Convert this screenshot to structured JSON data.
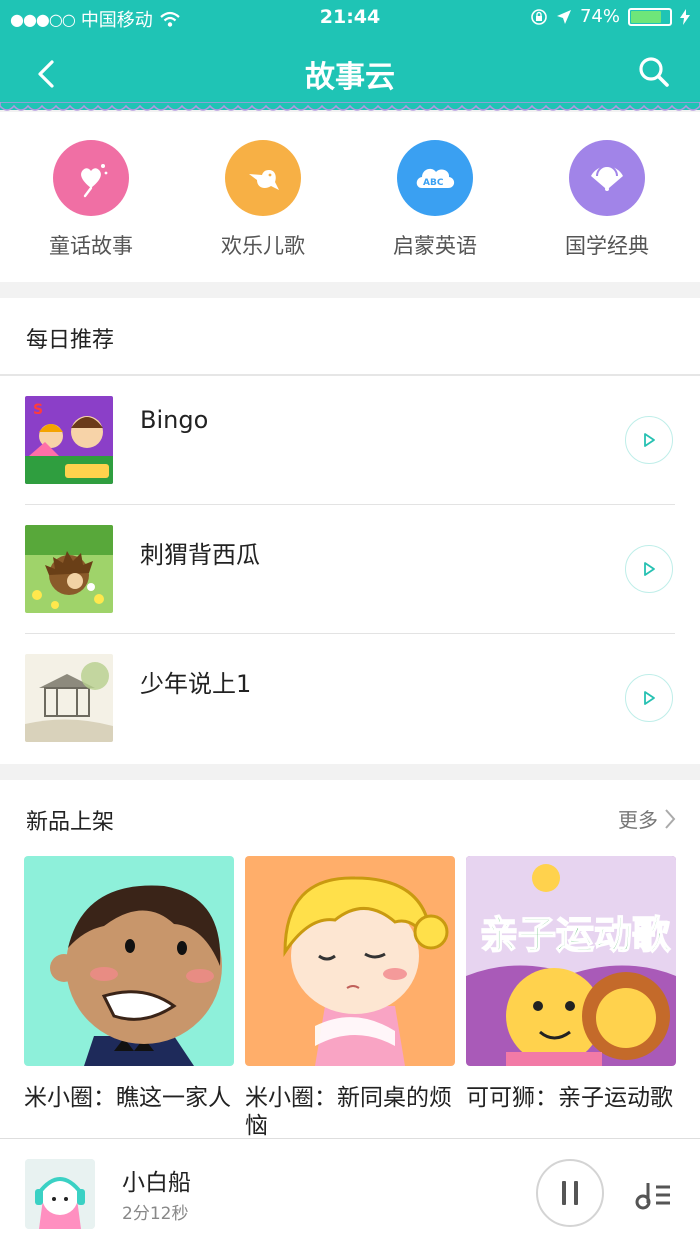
{
  "status_bar": {
    "signal_dots": "●●●○○",
    "carrier": "中国移动",
    "time": "21:44",
    "battery_percent": "74%",
    "battery_level": 0.74
  },
  "nav": {
    "title": "故事云",
    "back_icon": "chevron-left-icon",
    "search_icon": "search-icon"
  },
  "colors": {
    "brand": "#1fc4b5",
    "fairy": "#f06fa4",
    "songs": "#f7b045",
    "english": "#3aa0f2",
    "classics": "#a184e8"
  },
  "categories": [
    {
      "label": "童话故事",
      "icon": "lollipop-icon"
    },
    {
      "label": "欢乐儿歌",
      "icon": "bird-icon"
    },
    {
      "label": "启蒙英语",
      "icon": "abc-cloud-icon"
    },
    {
      "label": "国学经典",
      "icon": "fan-icon"
    }
  ],
  "daily": {
    "title": "每日推荐",
    "items": [
      {
        "title": "Bingo",
        "play_icon": "play-icon"
      },
      {
        "title": "刺猬背西瓜",
        "play_icon": "play-icon"
      },
      {
        "title": "少年说上1",
        "play_icon": "play-icon"
      }
    ]
  },
  "new_arrivals": {
    "title": "新品上架",
    "more": "更多",
    "items": [
      {
        "title": "米小圈：瞧这一家人"
      },
      {
        "title": "米小圈：新同桌的烦恼"
      },
      {
        "title": "可可狮：亲子运动歌",
        "art_text": "亲子运动歌"
      }
    ]
  },
  "player": {
    "title": "小白船",
    "subtitle": "2分12秒",
    "pause_icon": "pause-icon",
    "playlist_icon": "playlist-icon"
  }
}
